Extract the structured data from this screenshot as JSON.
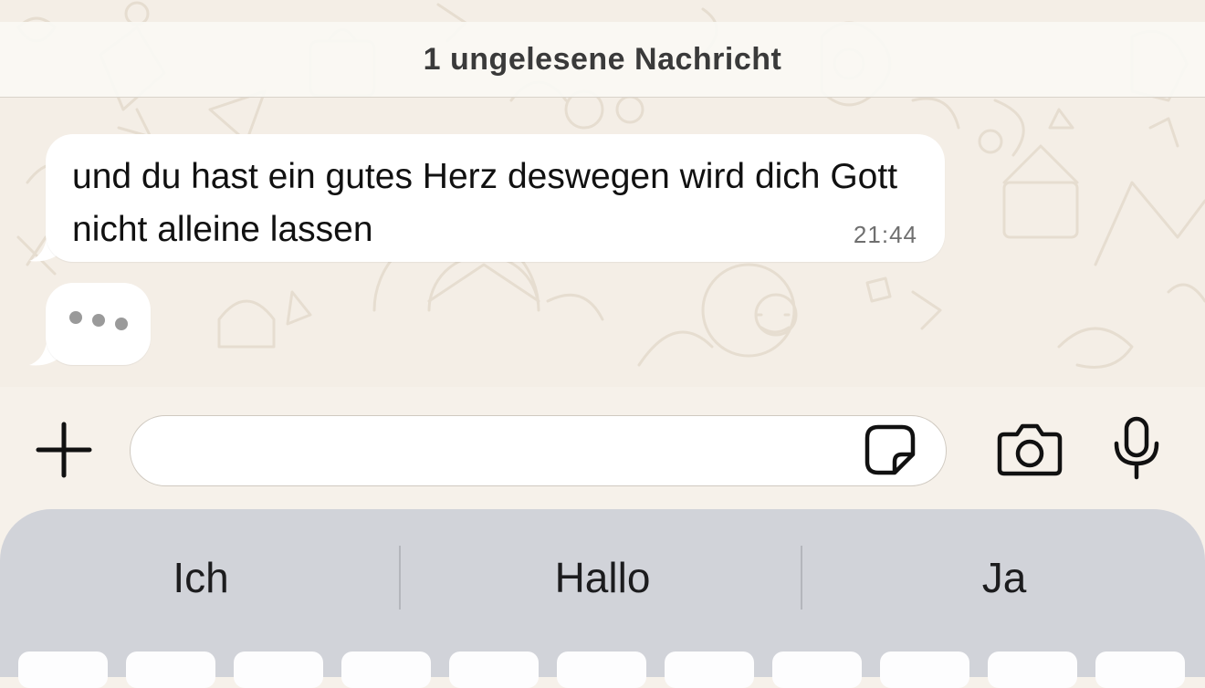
{
  "unread_banner": {
    "text": "1 ungelesene Nachricht"
  },
  "messages": [
    {
      "text": "und du hast ein gutes Herz deswegen wird dich Gott nicht alleine lassen",
      "time": "21:44"
    }
  ],
  "typing_indicator": {
    "visible": true
  },
  "composer": {
    "input_value": "",
    "icons": [
      "plus-icon",
      "sticker-icon",
      "camera-icon",
      "microphone-icon"
    ]
  },
  "keyboard": {
    "suggestions": [
      "Ich",
      "Hallo",
      "Ja"
    ]
  },
  "colors": {
    "chat_background": "#f4eee6",
    "bubble": "#ffffff",
    "keyboard": "#d1d3d9"
  }
}
